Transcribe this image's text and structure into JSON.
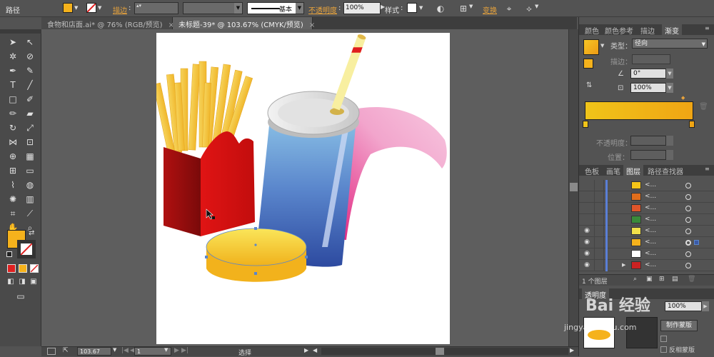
{
  "control_bar": {
    "selection_label": "路径",
    "fill_color": "#f5b21c",
    "stroke_label": "描边",
    "stroke_colon": ":",
    "brush_label": "基本",
    "opacity_label": "不透明度",
    "opacity_colon": ":",
    "opacity_value": "100%",
    "style_label": "样式",
    "style_colon": ":",
    "transform_label": "变换"
  },
  "document_tabs": [
    {
      "label": "食物和店面.ai* @ 76% (RGB/预览)",
      "close": "×"
    },
    {
      "label": "未标题-39* @ 103.67% (CMYK/预览)",
      "close": "×"
    }
  ],
  "gradient_panel": {
    "tabs": [
      "颜色",
      "颜色参考",
      "描边",
      "渐变"
    ],
    "type_label": "类型：",
    "type_value": "径向",
    "stroke_label": "描边：",
    "angle_value": "0°",
    "ratio_value": "100%",
    "opacity_label": "不透明度：",
    "position_label": "位置：",
    "gradient_start": "#f0c419",
    "gradient_end": "#f0a514"
  },
  "layers_panel": {
    "tabs": [
      "色板",
      "画笔",
      "图层",
      "路径查找器"
    ],
    "count_label": "1 个图层",
    "row_name": "<...",
    "rows": [
      {
        "thumb_color": "#f5c518"
      },
      {
        "thumb_color": "#e06d1b"
      },
      {
        "thumb_color": "#e0552a"
      },
      {
        "thumb_color": "#3a8a3a"
      },
      {
        "thumb_color": "#f2e04a"
      },
      {
        "thumb_color": "#f5b21c"
      },
      {
        "thumb_color": "#ffffff"
      },
      {
        "thumb_color": "#cc2222"
      }
    ]
  },
  "transparency_panel": {
    "tab_label": "透明度",
    "opacity_value": "100%",
    "make_mask_button": "制作蒙版",
    "invert_mask_label": "反相蒙版"
  },
  "status_bar": {
    "zoom_value": "103.67",
    "page_value": "1",
    "status_text": "选择"
  },
  "watermark": {
    "text": "Bai 经验",
    "url": "jingyan.baidu.com"
  }
}
